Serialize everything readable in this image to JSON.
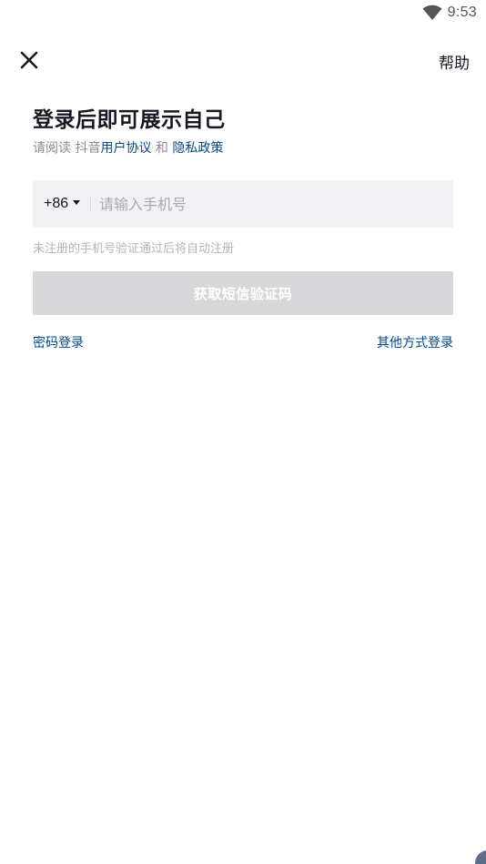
{
  "status_bar": {
    "time": "9:53",
    "wifi_icon": "wifi-icon"
  },
  "top_bar": {
    "close_icon": "close-icon",
    "help_label": "帮助"
  },
  "heading": {
    "title": "登录后即可展示自己",
    "agreement_prefix": "请阅读 抖音",
    "user_agreement": "用户协议",
    "and": " 和 ",
    "privacy_policy": "隐私政策"
  },
  "phone_field": {
    "country_code": "+86",
    "placeholder": "请输入手机号",
    "value": ""
  },
  "hint": "未注册的手机号验证通过后将自动注册",
  "sms_button_label": "获取短信验证码",
  "links": {
    "password_login": "密码登录",
    "other_login": "其他方式登录"
  },
  "colors": {
    "link": "#04498d",
    "button_disabled": "#d8d8da",
    "field_background": "#f2f2f4"
  }
}
